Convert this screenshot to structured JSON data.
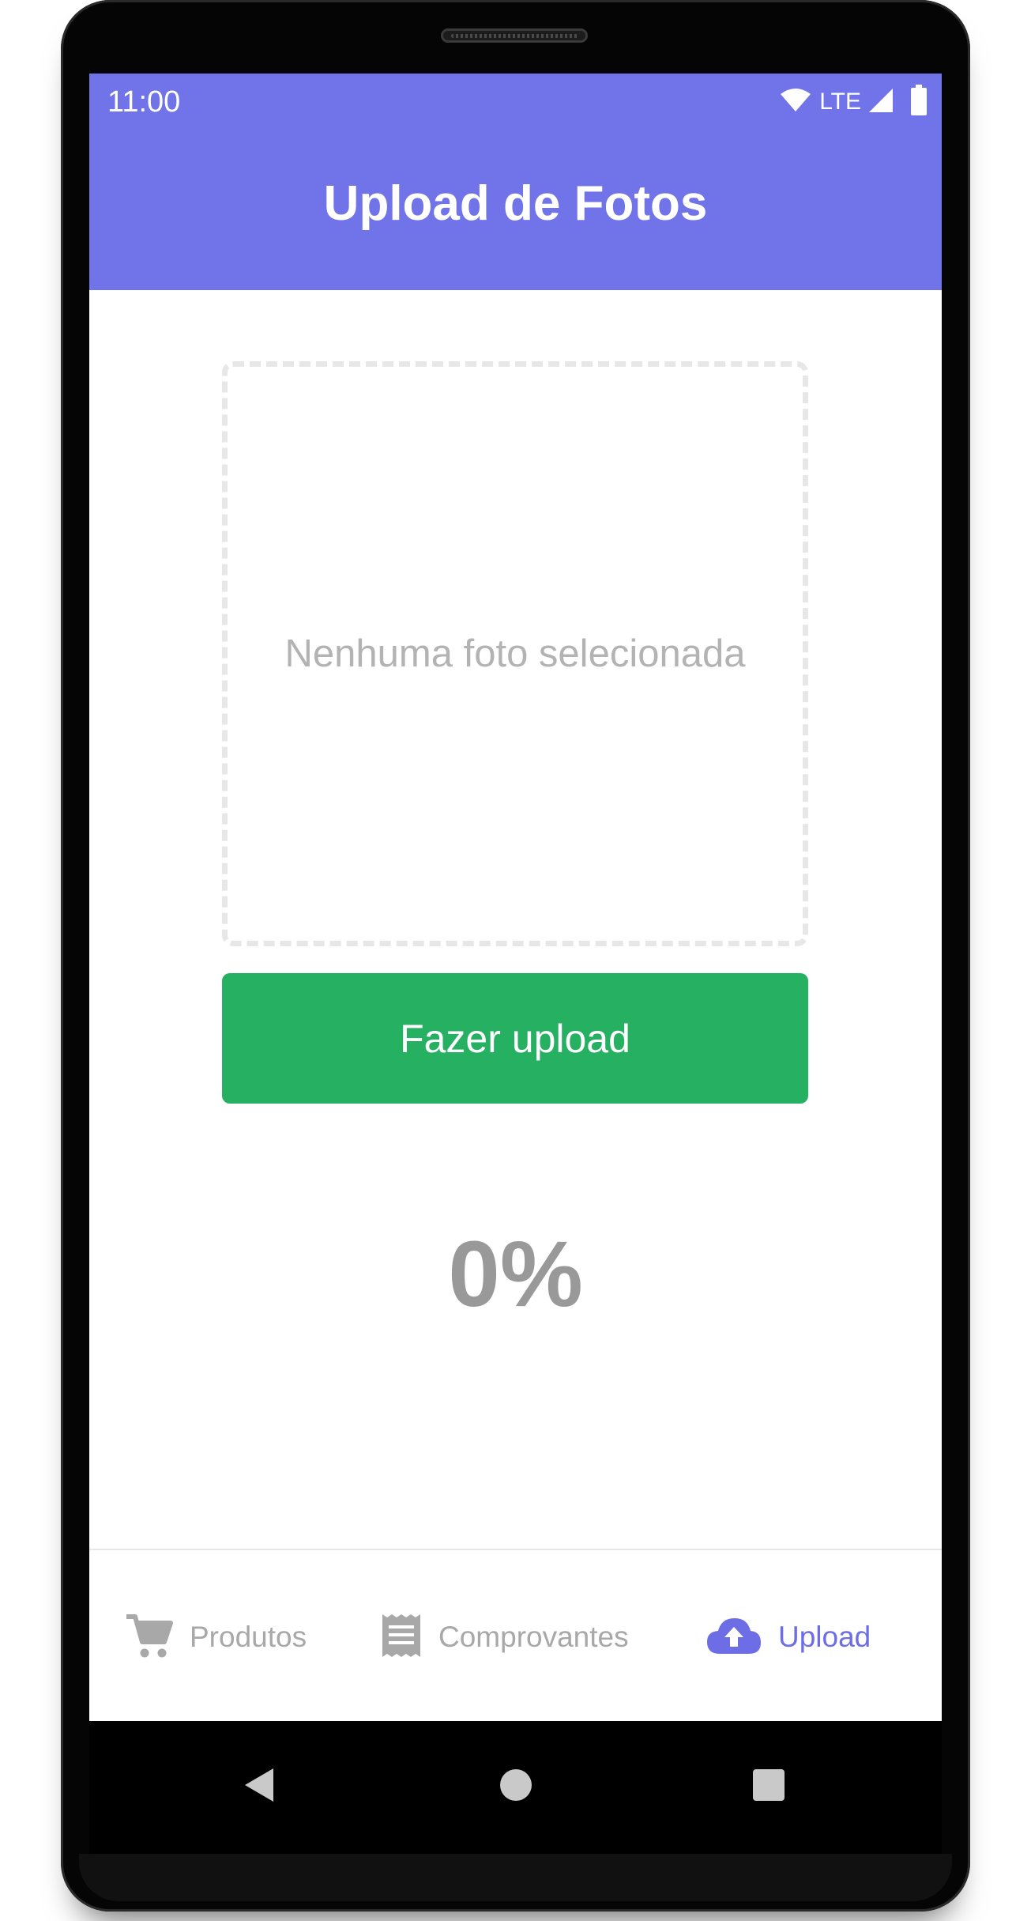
{
  "status_bar": {
    "time": "11:00",
    "network_label": "LTE",
    "icons": [
      "wifi-icon",
      "signal-icon",
      "battery-icon"
    ]
  },
  "app_bar": {
    "title": "Upload de Fotos",
    "color": "#7174e8"
  },
  "photo_preview": {
    "empty_text": "Nenhuma foto selecionada"
  },
  "upload_button": {
    "label": "Fazer upload",
    "color": "#25b062"
  },
  "progress": {
    "text": "0%",
    "value": 0
  },
  "bottom_nav": {
    "items": [
      {
        "label": "Produtos",
        "icon": "cart-icon",
        "active": false
      },
      {
        "label": "Comprovantes",
        "icon": "receipt-icon",
        "active": false
      },
      {
        "label": "Upload",
        "icon": "cloud-upload-icon",
        "active": true
      }
    ],
    "active_color": "#6d6ee6",
    "inactive_color": "#a8a8a8"
  },
  "system_nav": {
    "buttons": [
      "back-icon",
      "home-icon",
      "recents-icon"
    ]
  }
}
